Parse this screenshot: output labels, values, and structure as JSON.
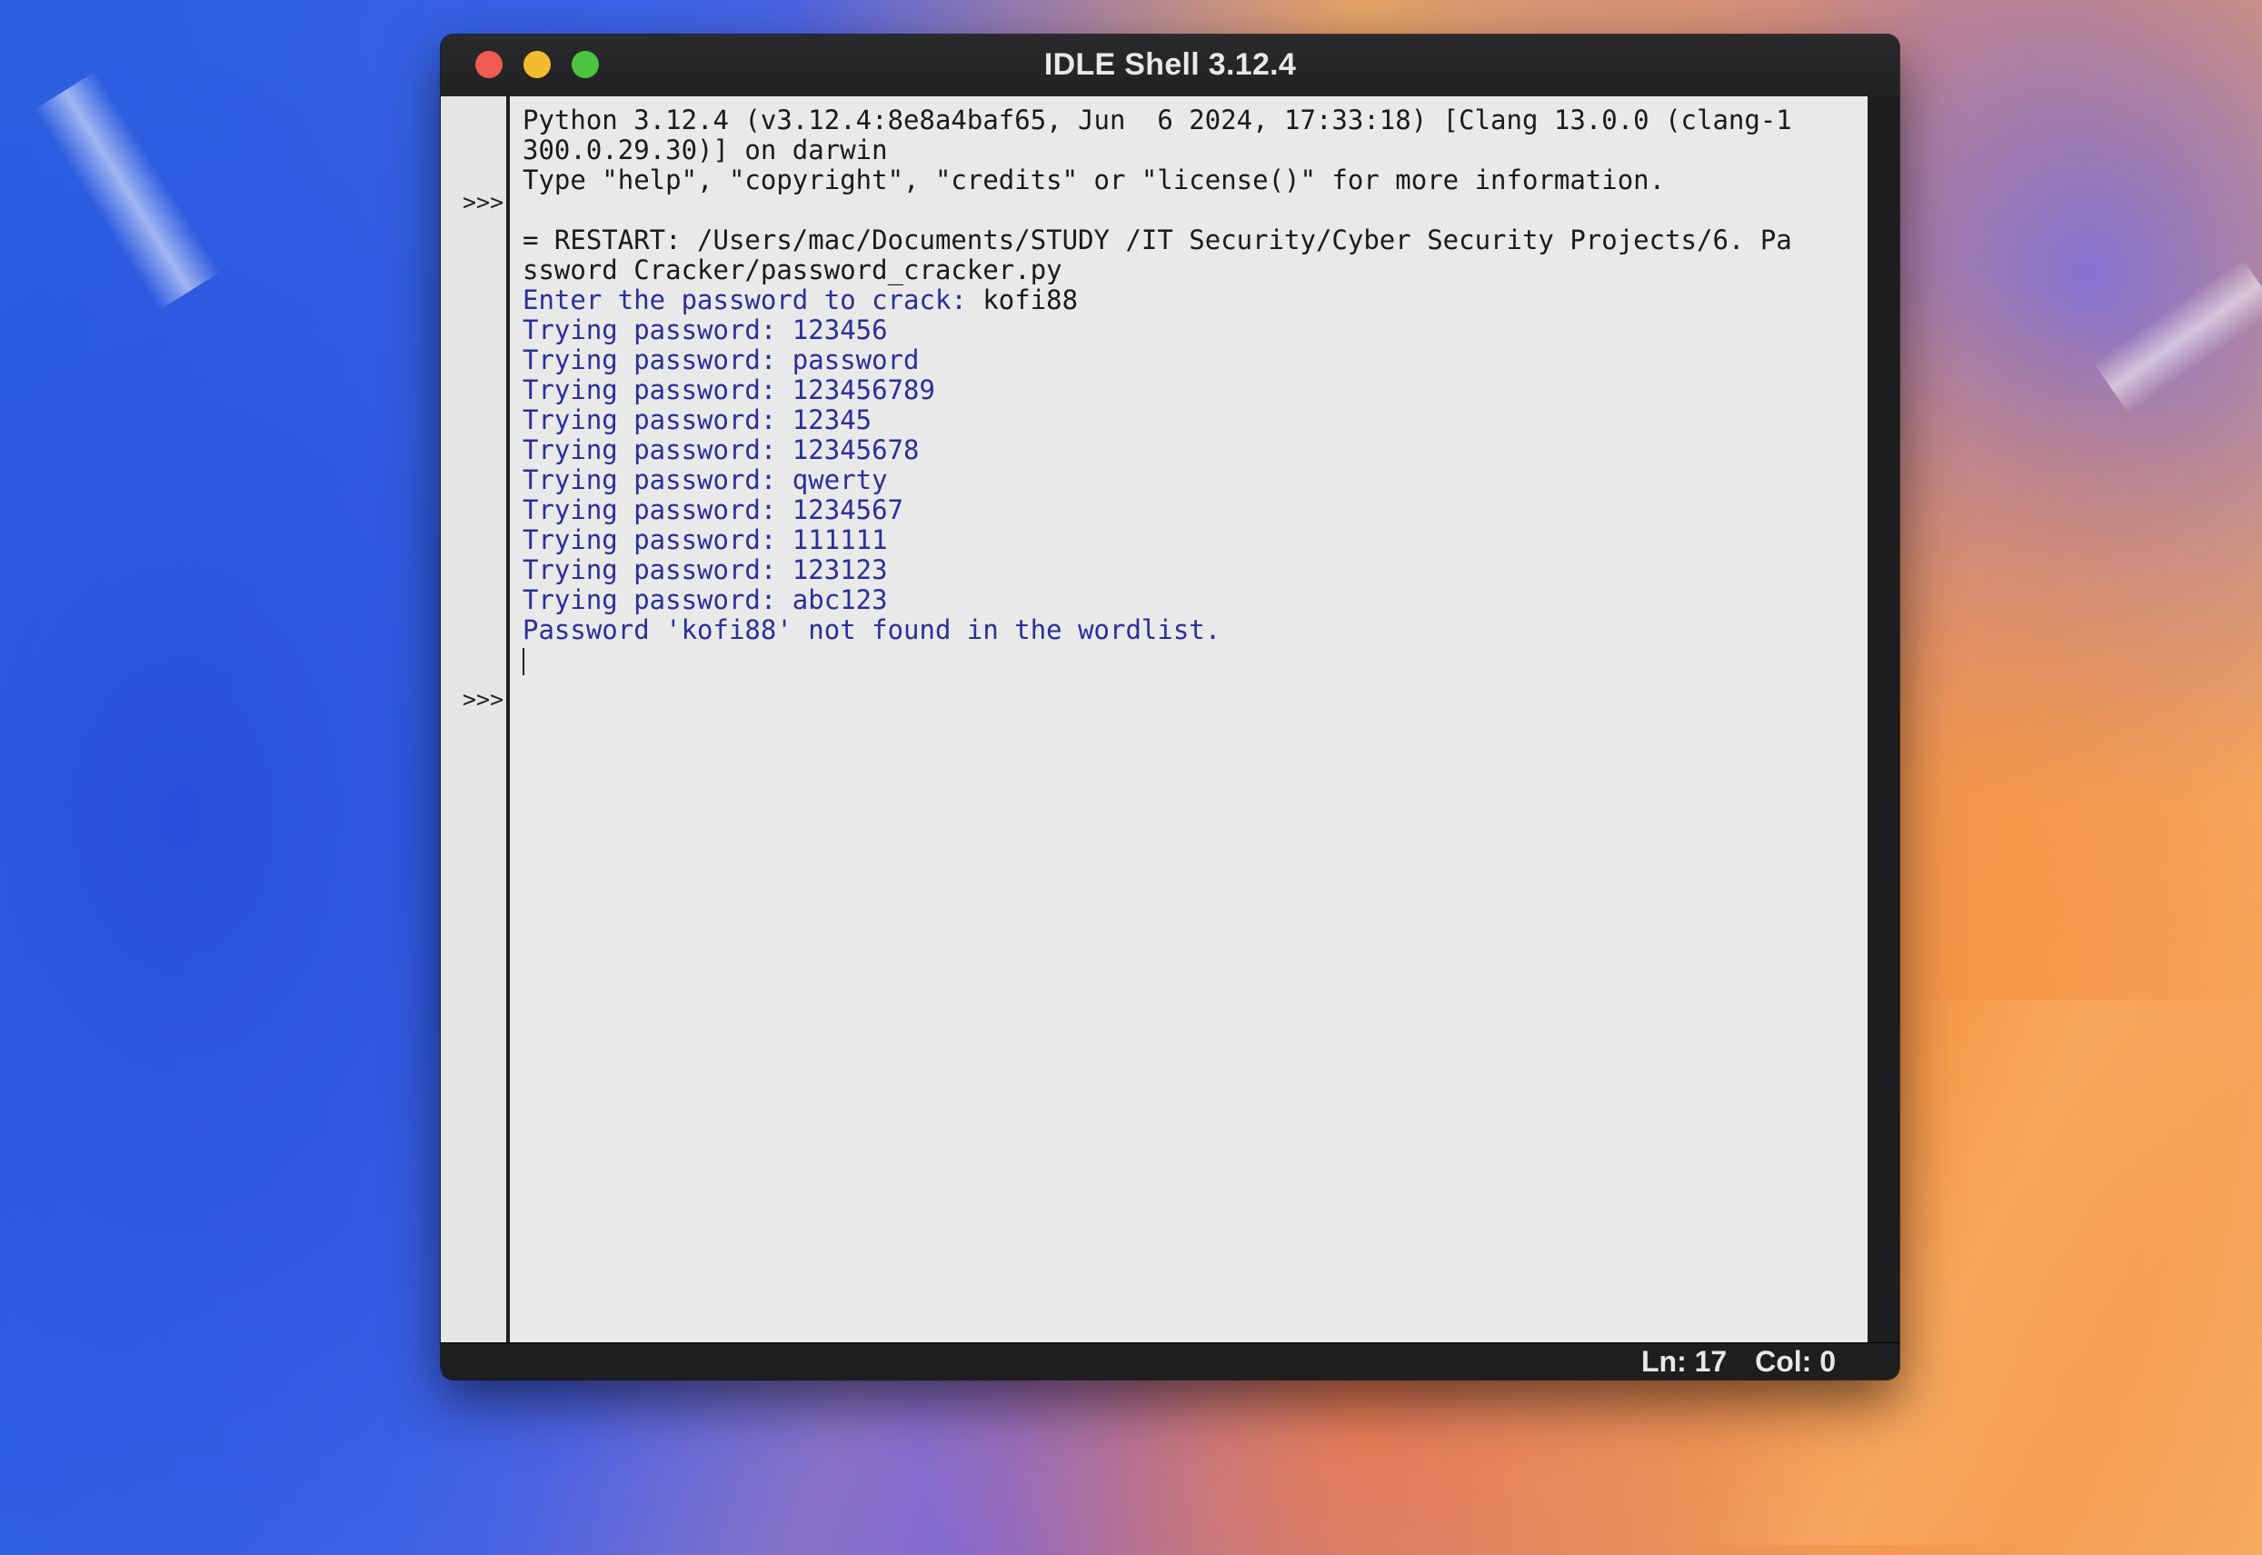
{
  "window": {
    "title": "IDLE Shell 3.12.4"
  },
  "shell": {
    "prompts": [
      ">>>",
      ">>>"
    ],
    "lines": [
      {
        "text": "Python 3.12.4 (v3.12.4:8e8a4baf65, Jun  6 2024, 17:33:18) [Clang 13.0.0 (clang-1",
        "kind": "out"
      },
      {
        "text": "300.0.29.30)] on darwin",
        "kind": "out"
      },
      {
        "text": "Type \"help\", \"copyright\", \"credits\" or \"license()\" for more information.",
        "kind": "out"
      },
      {
        "text": "",
        "kind": "out"
      },
      {
        "text": "= RESTART: /Users/mac/Documents/STUDY /IT Security/Cyber Security Projects/6. Pa",
        "kind": "out"
      },
      {
        "text": "ssword Cracker/password_cracker.py",
        "kind": "out"
      },
      {
        "text": "Enter the password to crack: ",
        "kind": "prog",
        "input": "kofi88"
      },
      {
        "text": "Trying password: 123456",
        "kind": "prog"
      },
      {
        "text": "Trying password: password",
        "kind": "prog"
      },
      {
        "text": "Trying password: 123456789",
        "kind": "prog"
      },
      {
        "text": "Trying password: 12345",
        "kind": "prog"
      },
      {
        "text": "Trying password: 12345678",
        "kind": "prog"
      },
      {
        "text": "Trying password: qwerty",
        "kind": "prog"
      },
      {
        "text": "Trying password: 1234567",
        "kind": "prog"
      },
      {
        "text": "Trying password: 111111",
        "kind": "prog"
      },
      {
        "text": "Trying password: 123123",
        "kind": "prog"
      },
      {
        "text": "Trying password: abc123",
        "kind": "prog"
      },
      {
        "text": "Password 'kofi88' not found in the wordlist.",
        "kind": "prog"
      }
    ]
  },
  "status": {
    "line": "Ln: 17",
    "col": "Col: 0"
  },
  "colors": {
    "program_output": "#2a2f9a",
    "close": "#ee5b52",
    "minimize": "#f3bb2f",
    "zoom": "#4bc43f"
  }
}
